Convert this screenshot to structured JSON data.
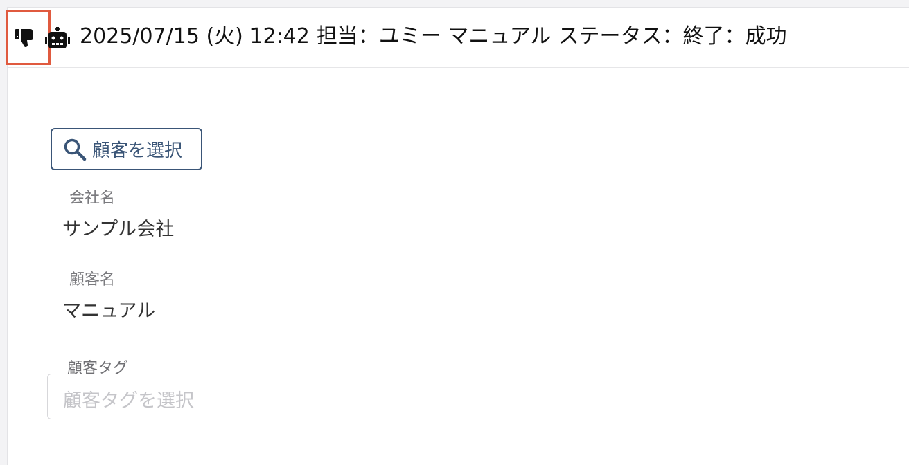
{
  "header": {
    "date": "2025/07/15 (火) 12:42",
    "assignee": "担当：ユミー マニュアル",
    "status": "ステータス：終了：成功",
    "feedback_icon": "thumbs-down-icon",
    "bot_icon": "robot-icon",
    "highlight_color": "#e05a3f"
  },
  "customer": {
    "select_button_label": "顧客を選択",
    "company_label": "会社名",
    "company_value": "サンプル会社",
    "name_label": "顧客名",
    "name_value": "マニュアル",
    "tag_label": "顧客タグ",
    "tag_placeholder": "顧客タグを選択"
  },
  "colors": {
    "accent": "#3a5577",
    "text": "#111111",
    "muted": "#7a7a7e",
    "placeholder": "#c5c5c9"
  }
}
